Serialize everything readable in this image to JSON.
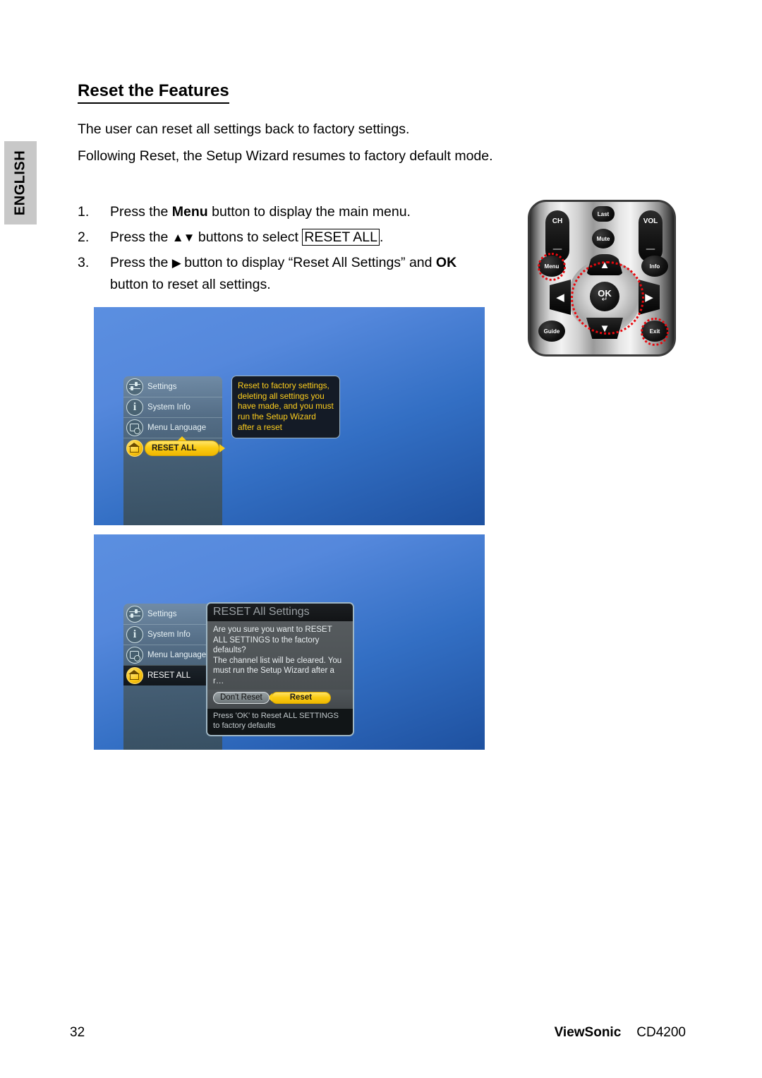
{
  "sidebar": {
    "language_tab": "ENGLISH"
  },
  "heading": "Reset the Features",
  "intro": {
    "p1": "The user can reset all settings back to factory settings.",
    "p2_a": "Following Reset, the Setup Wizard resumes to factory default",
    "p2_b": "mode."
  },
  "steps": [
    {
      "num": "1.",
      "pre": "Press the ",
      "bold": "Menu",
      "post": " button to display the main menu."
    },
    {
      "num": "2.",
      "pre": "Press the ",
      "glyph": "▲▼",
      "mid": " buttons to select ",
      "boxed": "RESET ALL",
      "post": "."
    },
    {
      "num": "3.",
      "pre": "Press the ",
      "glyph": "▶",
      "mid": " button to display “Reset All Settings” and ",
      "bold": "OK",
      "post": "",
      "line2": "button to reset all settings."
    }
  ],
  "remote": {
    "buttons": {
      "ch": "CH",
      "vol": "VOL",
      "last": "Last",
      "mute": "Mute",
      "menu": "Menu",
      "info": "Info",
      "guide": "Guide",
      "exit": "Exit",
      "ok": "OK",
      "ok_sub": "↵",
      "up": "▲",
      "down": "▼",
      "left": "◀",
      "right": "▶"
    },
    "highlight_color": "#e8080d"
  },
  "osd1": {
    "menu_items": [
      {
        "label": "Settings",
        "icon": "sliders-icon"
      },
      {
        "label": "System Info",
        "icon": "info-icon"
      },
      {
        "label": "Menu Language",
        "icon": "language-icon"
      },
      {
        "label": "RESET ALL",
        "icon": "home-icon"
      }
    ],
    "tooltip": "Reset to factory settings, deleting all settings you have made, and you must run the Setup Wizard after a reset",
    "highlight_color": "#fbcc15"
  },
  "osd2": {
    "menu_items": [
      {
        "label": "Settings",
        "icon": "sliders-icon"
      },
      {
        "label": "System Info",
        "icon": "info-icon"
      },
      {
        "label": "Menu Language",
        "icon": "language-icon"
      },
      {
        "label": "RESET ALL",
        "icon": "home-icon"
      }
    ],
    "dialog": {
      "title": "RESET All Settings",
      "body_line1": "Are you sure you want to RESET ALL SETTINGS to the factory defaults?",
      "body_line2": "The channel list will be cleared. You must run the Setup Wizard after a r…",
      "dont_reset_label": "Don't Reset",
      "reset_label": "Reset",
      "footer": "Press 'OK' to Reset ALL SETTINGS to factory defaults"
    }
  },
  "footer": {
    "page_number": "32",
    "brand": "ViewSonic",
    "model": "CD4200"
  }
}
